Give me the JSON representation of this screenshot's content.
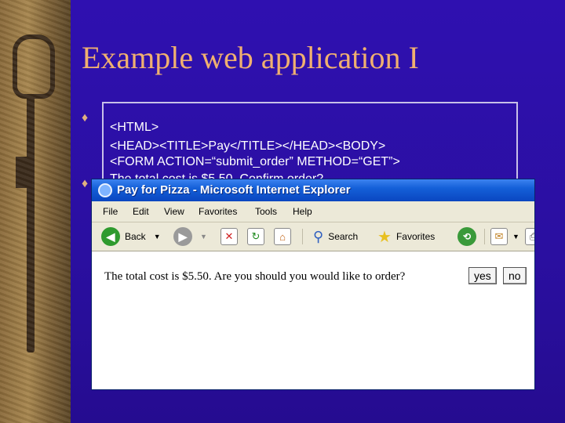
{
  "slide": {
    "title": "Example web application I",
    "bullet_glyph": "♦",
    "code_lines": [
      "<HTML>",
      "<HEAD><TITLE>Pay</TITLE></HEAD><BODY>",
      "<FORM ACTION=“submit_order” METHOD=“GET”>",
      "The total cost is $5.50. Confirm order?"
    ]
  },
  "browser": {
    "window_title": "Pay for Pizza - Microsoft Internet Explorer",
    "menu": [
      "File",
      "Edit",
      "View",
      "Favorites",
      "Tools",
      "Help"
    ],
    "toolbar": {
      "back_label": "Back",
      "search_label": "Search",
      "favorites_label": "Favorites"
    },
    "page": {
      "message": "The total cost is $5.50. Are you should you would like to order?",
      "yes_label": "yes",
      "no_label": "no"
    }
  },
  "colors": {
    "slide_bg": "#2a0fa0",
    "title": "#f0b070",
    "ie_titlebar": "#0a46c0"
  }
}
